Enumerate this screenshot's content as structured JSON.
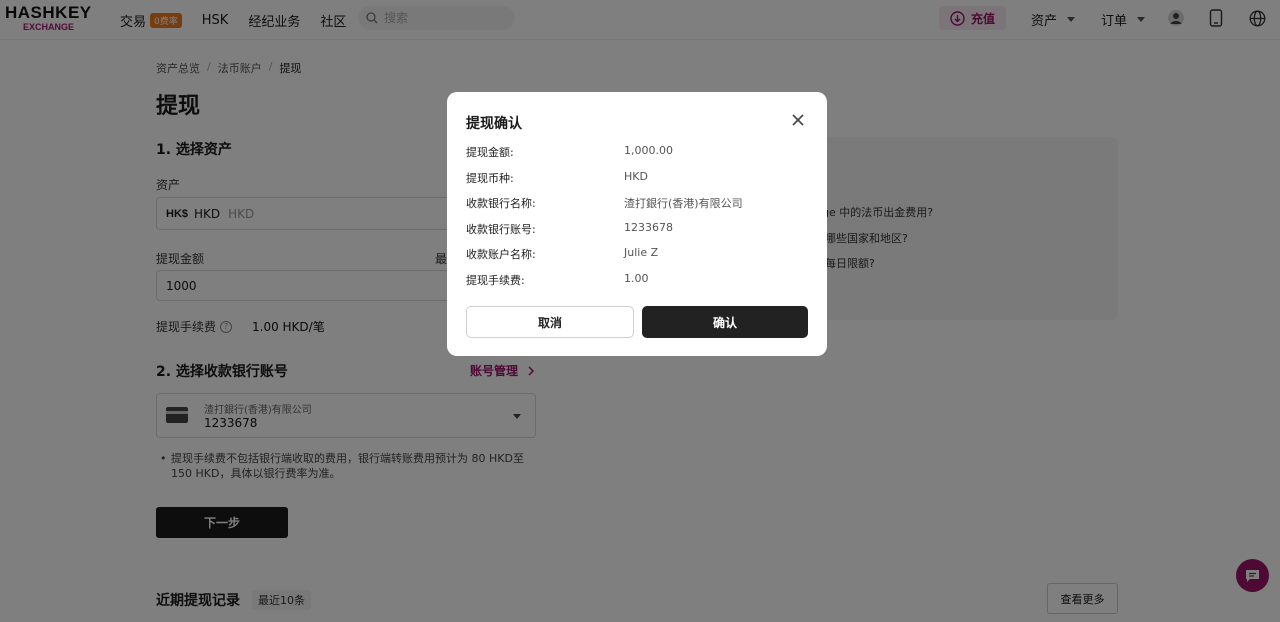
{
  "header": {
    "logo_top": "HASHKEY",
    "logo_bottom": "EXCHANGE",
    "nav": [
      {
        "label": "交易",
        "badge": "0费率"
      },
      {
        "label": "HSK"
      },
      {
        "label": "经纪业务"
      },
      {
        "label": "社区"
      }
    ],
    "search_placeholder": "搜索",
    "deposit_label": "充值",
    "assets_label": "资产",
    "orders_label": "订单",
    "icons": [
      "user-icon",
      "mobile-icon",
      "globe-icon"
    ]
  },
  "breadcrumb": [
    "资产总览",
    "法币账户",
    "提现"
  ],
  "page_title": "提现",
  "step1": {
    "heading": "1. 选择资产",
    "asset_label": "资产",
    "asset_code": "HKD",
    "asset_name": "HKD",
    "asset_logo": "HK$",
    "amount_label": "提现金额",
    "amount_side_label": "最",
    "amount_value": "1000",
    "fee_label": "提现手续费",
    "fee_value": "1.00 HKD/笔"
  },
  "step2": {
    "heading": "2. 选择收款银行账号",
    "manage_link": "账号管理",
    "bank_name": "渣打銀行(香港)有限公司",
    "bank_account": "1233678",
    "note": "提现手续费不包括银行端收取的费用，银行端转账费用预计为 80 HKD至 150 HKD，具体以银行费率为准。"
  },
  "next_button": "下一步",
  "recent": {
    "heading": "近期提现记录",
    "badge": "最近10条",
    "more_button": "查看更多"
  },
  "faq": [
    "nge 中的法币出金费用?",
    "哪些国家和地区?",
    "每日限额?"
  ],
  "modal": {
    "title": "提现确认",
    "rows": [
      {
        "label": "提现金额:",
        "value": "1,000.00"
      },
      {
        "label": "提现币种:",
        "value": "HKD"
      },
      {
        "label": "收款银行名称:",
        "value": "渣打銀行(香港)有限公司"
      },
      {
        "label": "收款银行账号:",
        "value": "1233678"
      },
      {
        "label": "收款账户名称:",
        "value": "Julie Z"
      },
      {
        "label": "提现手续费:",
        "value": "1.00"
      }
    ],
    "cancel_label": "取消",
    "confirm_label": "确认"
  },
  "colors": {
    "brand": "#9c1468",
    "dark_button": "#1a1a1a",
    "hot_badge": "#f07a1e"
  }
}
